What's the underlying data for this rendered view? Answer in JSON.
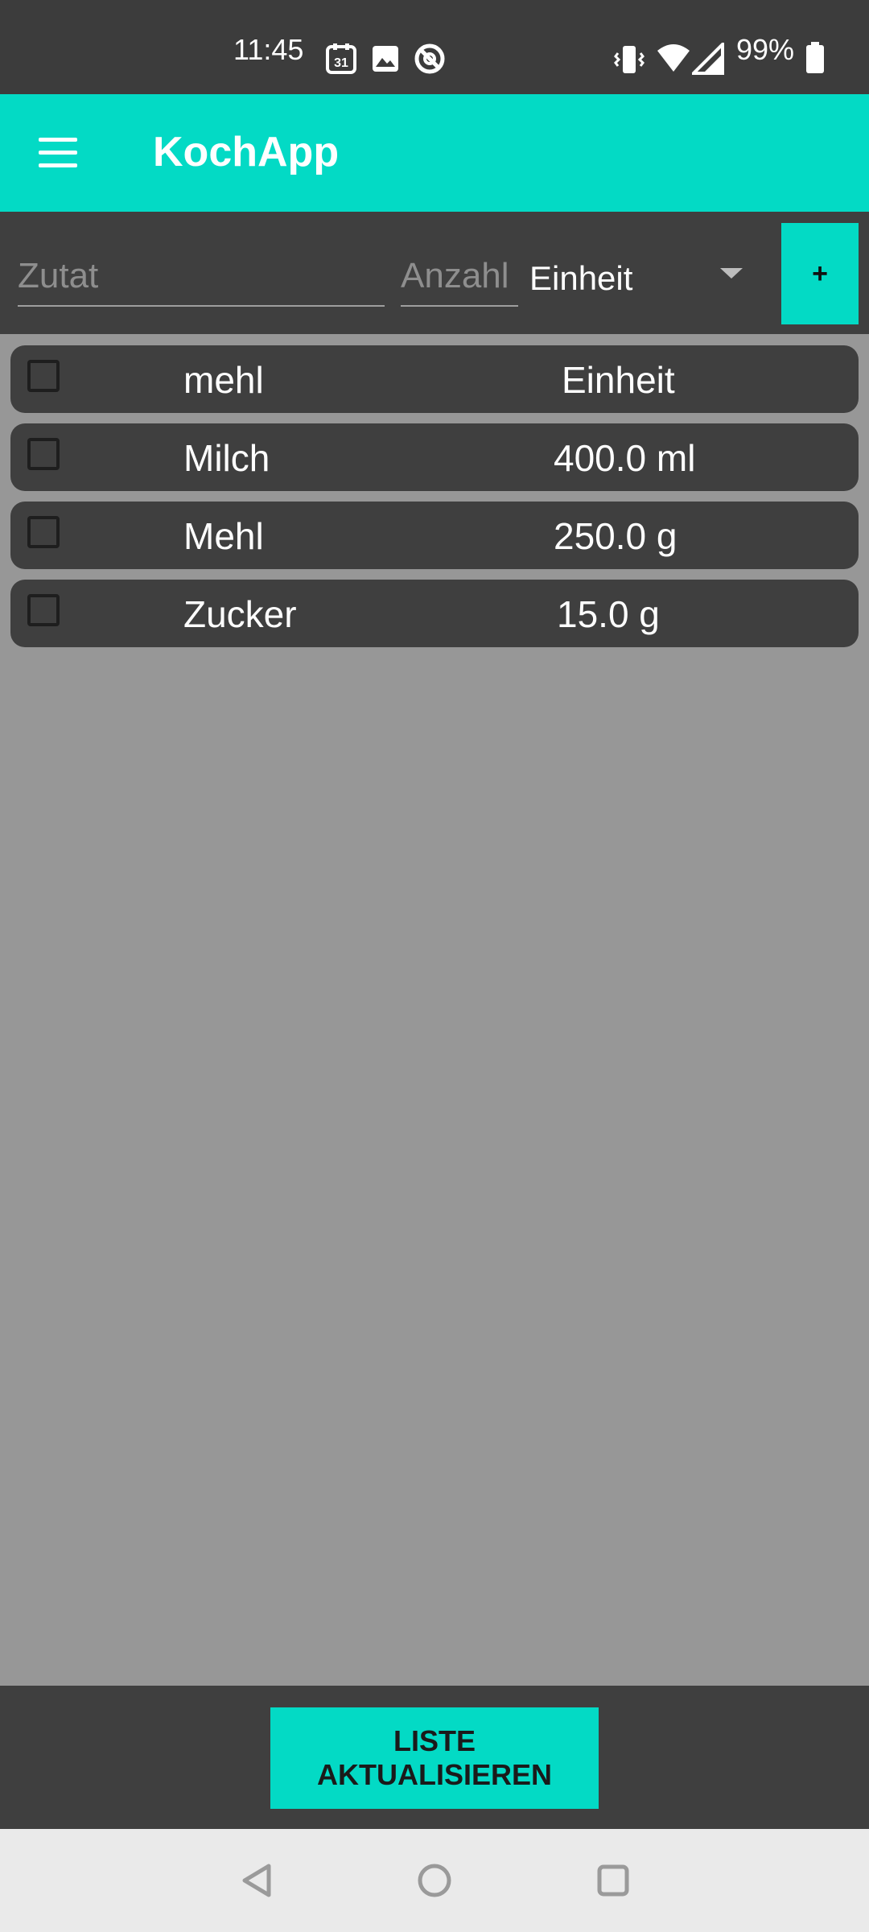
{
  "status_bar": {
    "time": "11:45",
    "calendar_day": "31",
    "battery_percent": "99%",
    "icons": [
      "calendar-icon",
      "image-icon",
      "do-not-disturb-icon",
      "vibrate-icon",
      "wifi-icon",
      "cell-signal-icon",
      "battery-icon"
    ]
  },
  "app_bar": {
    "title": "KochApp",
    "menu_icon": "hamburger-menu-icon"
  },
  "input_row": {
    "ingredient_placeholder": "Zutat",
    "ingredient_value": "",
    "amount_placeholder": "Anzahl",
    "amount_value": "",
    "unit_selected": "Einheit",
    "add_label": "+"
  },
  "ingredients": [
    {
      "name": "mehl",
      "amount": "Einheit",
      "checked": false
    },
    {
      "name": "Milch",
      "amount": "400.0 ml",
      "checked": false
    },
    {
      "name": "Mehl",
      "amount": "250.0 g",
      "checked": false
    },
    {
      "name": "Zucker",
      "amount": "15.0 g",
      "checked": false
    }
  ],
  "footer": {
    "update_label": "LISTE AKTUALISIEREN"
  },
  "colors": {
    "accent": "#03dac5",
    "dark_surface": "#3f3f3f",
    "background": "#979797",
    "nav_bar": "#eaeaea"
  }
}
